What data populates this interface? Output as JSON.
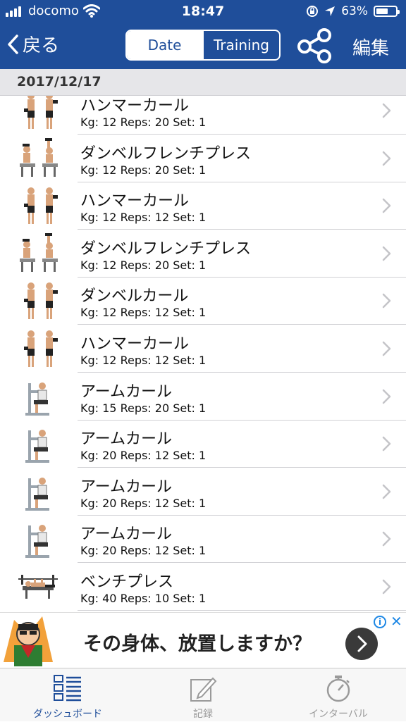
{
  "status": {
    "carrier": "docomo",
    "time": "18:47",
    "battery_text": "63%",
    "battery_level": 0.63
  },
  "nav": {
    "back_label": "戻る",
    "segment": [
      "Date",
      "Training"
    ],
    "selected_segment": "Date",
    "edit_label": "編集"
  },
  "date_header": "2017/12/17",
  "entries": [
    {
      "name": "ハンマーカール",
      "detail": "Kg: 12 Reps: 20 Set: 1",
      "illustration": "standing-curl-icon"
    },
    {
      "name": "ダンベルフレンチプレス",
      "detail": "Kg: 12 Reps: 20 Set: 1",
      "illustration": "seated-press-icon"
    },
    {
      "name": "ハンマーカール",
      "detail": "Kg: 12 Reps: 12 Set: 1",
      "illustration": "standing-curl-icon"
    },
    {
      "name": "ダンベルフレンチプレス",
      "detail": "Kg: 12 Reps: 20 Set: 1",
      "illustration": "seated-press-icon"
    },
    {
      "name": "ダンベルカール",
      "detail": "Kg: 12 Reps: 12 Set: 1",
      "illustration": "standing-curl-icon"
    },
    {
      "name": "ハンマーカール",
      "detail": "Kg: 12 Reps: 12 Set: 1",
      "illustration": "standing-curl-icon"
    },
    {
      "name": "アームカール",
      "detail": "Kg: 15 Reps: 20 Set: 1",
      "illustration": "machine-curl-icon"
    },
    {
      "name": "アームカール",
      "detail": "Kg: 20 Reps: 12 Set: 1",
      "illustration": "machine-curl-icon"
    },
    {
      "name": "アームカール",
      "detail": "Kg: 20 Reps: 12 Set: 1",
      "illustration": "machine-curl-icon"
    },
    {
      "name": "アームカール",
      "detail": "Kg: 20 Reps: 12 Set: 1",
      "illustration": "machine-curl-icon"
    },
    {
      "name": "ベンチプレス",
      "detail": "Kg: 40 Reps: 10 Set: 1",
      "illustration": "bench-press-icon"
    }
  ],
  "ad": {
    "text": "その身体、放置しますか？"
  },
  "tabbar": [
    {
      "label": "ダッシュボード",
      "icon": "dashboard-icon",
      "active": true
    },
    {
      "label": "記録",
      "icon": "pencil-note-icon",
      "active": false
    },
    {
      "label": "インターバル",
      "icon": "stopwatch-icon",
      "active": false
    }
  ],
  "colors": {
    "nav_blue": "#1f4e9a",
    "active_tab": "#1f4e9a",
    "inactive_tab": "#9a9a9a",
    "ad_info": "#1e88e5"
  }
}
